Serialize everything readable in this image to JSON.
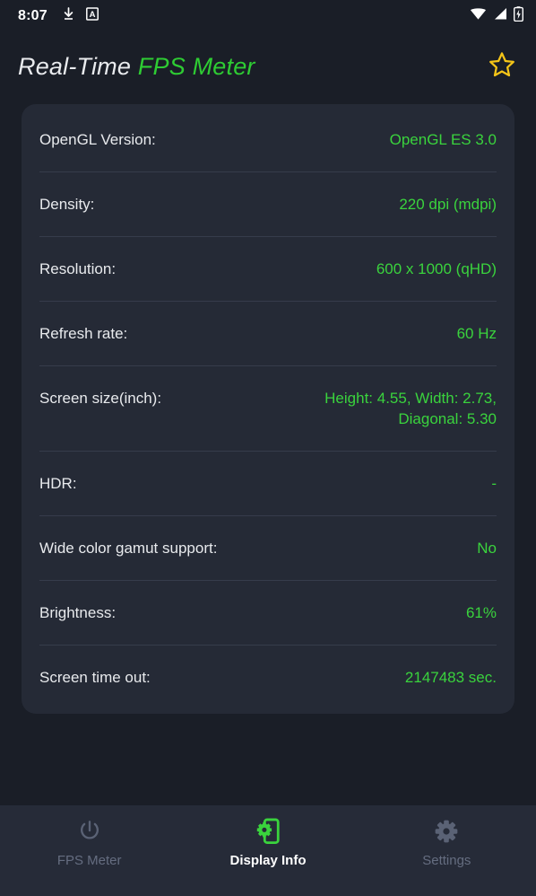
{
  "status_bar": {
    "time": "8:07",
    "left_icons": [
      "download-icon",
      "app-badge-a-icon"
    ],
    "right_icons": [
      "wifi-icon",
      "cellular-signal-icon",
      "battery-charging-icon"
    ],
    "badge_letter": "A"
  },
  "header": {
    "title_primary": "Real-Time ",
    "title_accent": "FPS Meter",
    "star_icon": "star-outline-icon"
  },
  "colors": {
    "page_background": "#1a1e27",
    "card_background": "#252a36",
    "accent_green": "#3ad33d",
    "title_green": "#2ecc33",
    "star_yellow": "#f5c518",
    "label_white": "#e8eaed",
    "nav_background": "#262b38",
    "nav_inactive": "#656d80",
    "divider": "#363c4b"
  },
  "display_info": {
    "rows": [
      {
        "label": "OpenGL Version:",
        "value": "OpenGL ES 3.0"
      },
      {
        "label": "Density:",
        "value": "220 dpi (mdpi)"
      },
      {
        "label": "Resolution:",
        "value": "600 x 1000 (qHD)"
      },
      {
        "label": "Refresh rate:",
        "value": "60 Hz"
      },
      {
        "label": "Screen size(inch):",
        "value": "Height: 4.55, Width: 2.73,\nDiagonal: 5.30"
      },
      {
        "label": "HDR:",
        "value": "-"
      },
      {
        "label": "Wide color gamut support:",
        "value": "No"
      },
      {
        "label": "Brightness:",
        "value": "61%"
      },
      {
        "label": "Screen time out:",
        "value": "2147483 sec."
      }
    ]
  },
  "bottom_nav": {
    "items": [
      {
        "label": "FPS Meter",
        "icon": "power-icon",
        "active": false
      },
      {
        "label": "Display Info",
        "icon": "phone-gear-icon",
        "active": true
      },
      {
        "label": "Settings",
        "icon": "gear-icon",
        "active": false
      }
    ]
  }
}
